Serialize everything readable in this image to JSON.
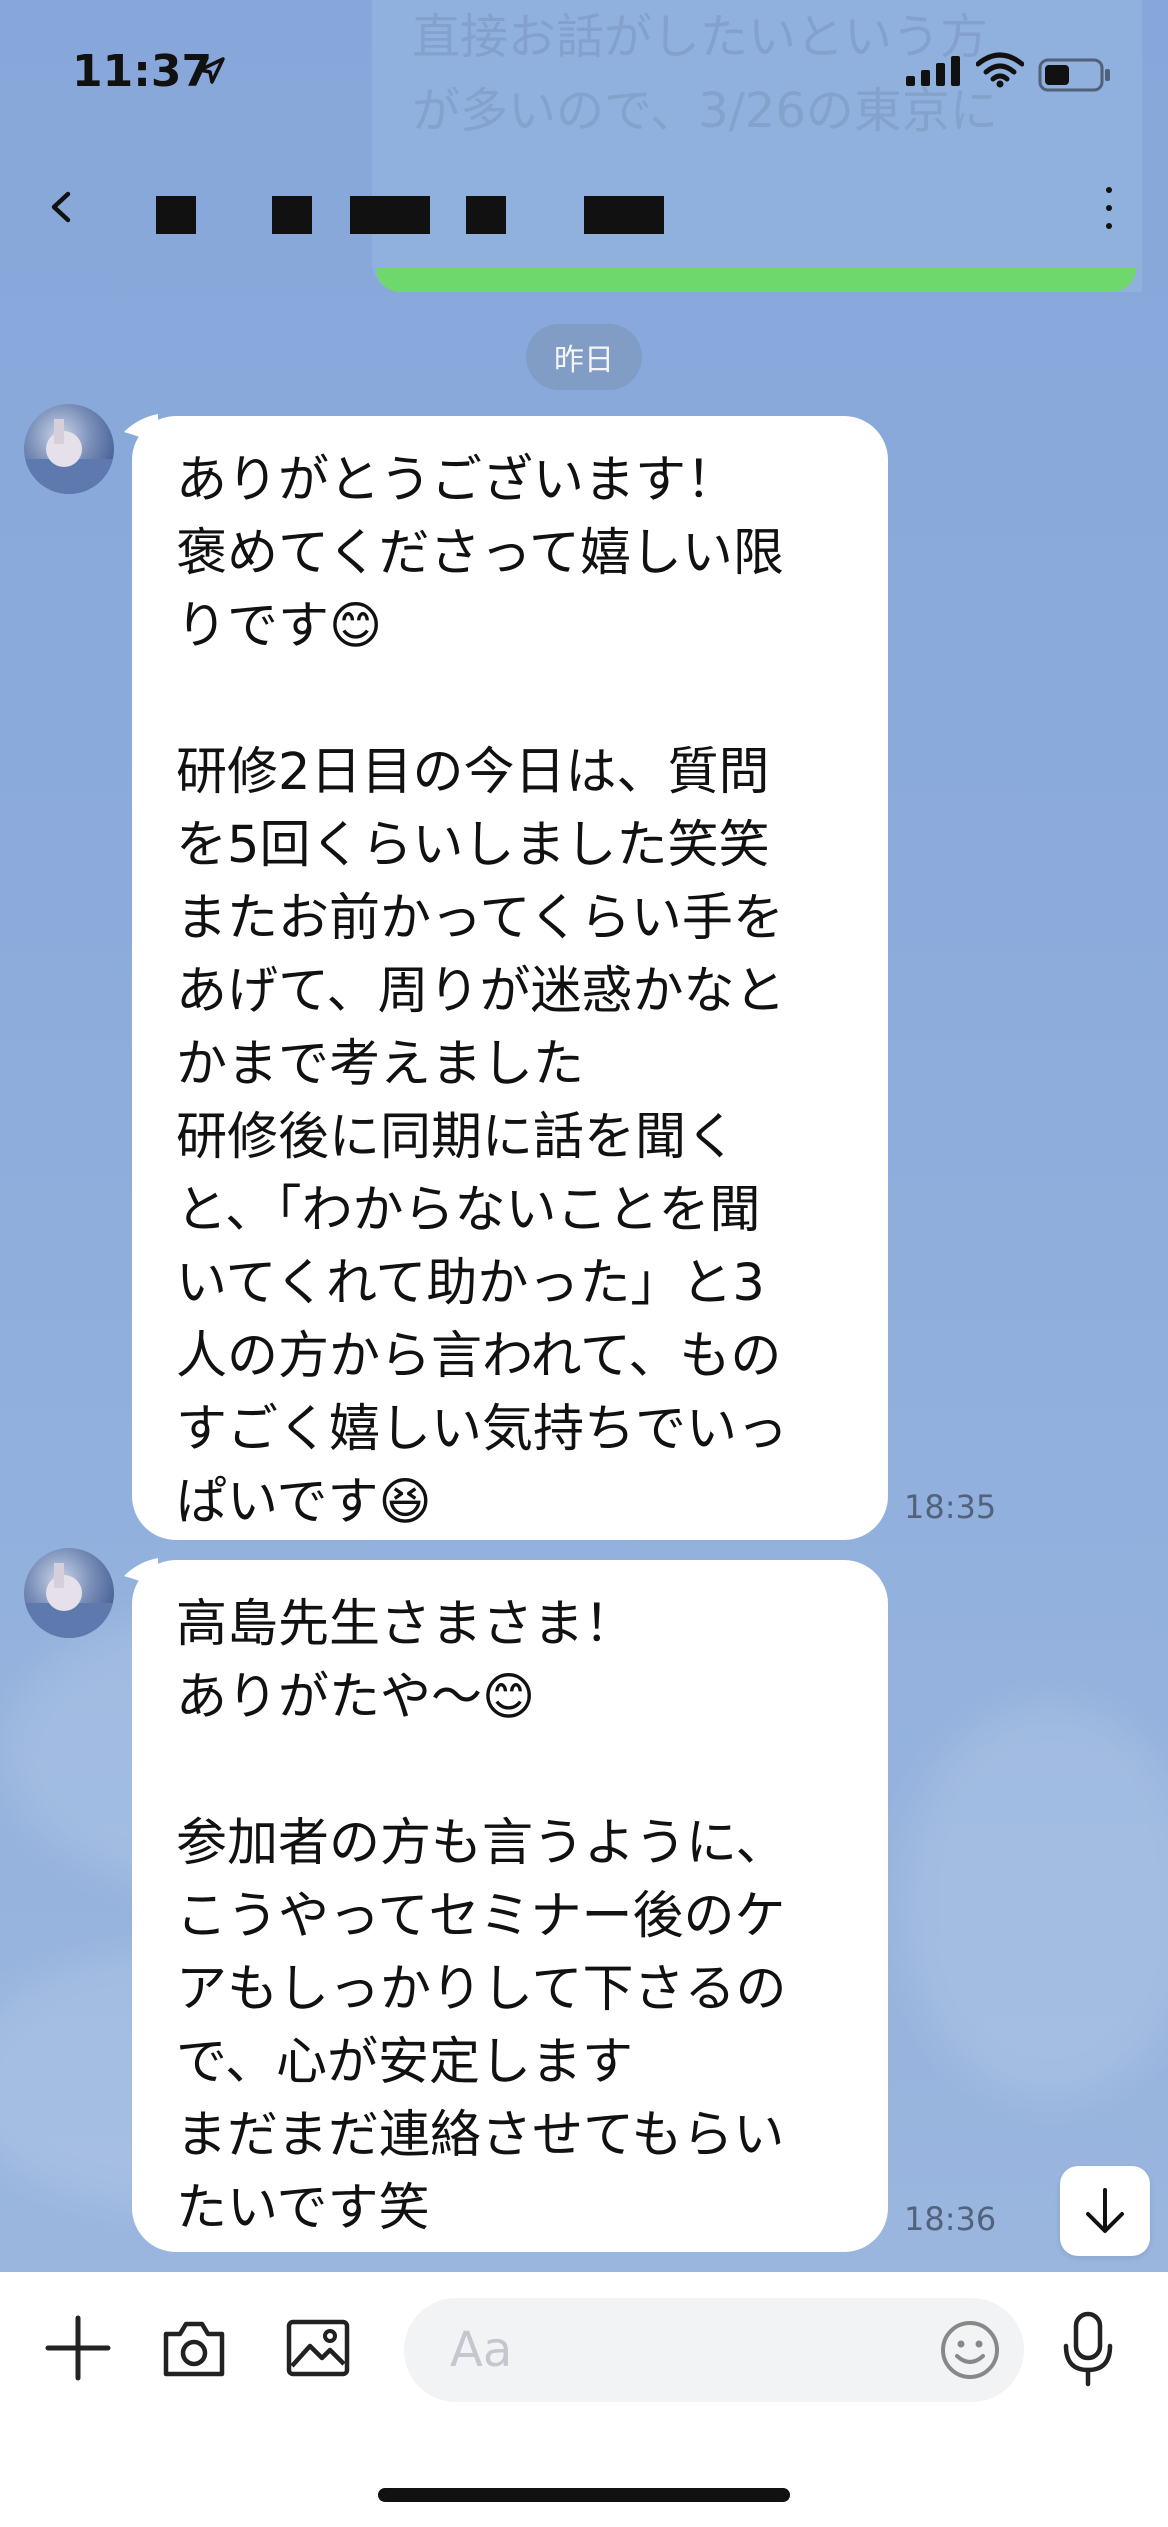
{
  "status_bar": {
    "time": "11:37"
  },
  "banner": {
    "line1": "直接お話がしたいという方",
    "line2": "が多いので、3/26の東京に"
  },
  "header": {
    "back_icon": "chevron-left-icon",
    "menu_icon": "more-vertical-icon"
  },
  "date_separator": "昨日",
  "messages": [
    {
      "text": "ありがとうございます！\n褒めてくださって嬉しい限\nりです😊\n\n研修2日目の今日は、質問\nを5回くらいしました笑笑\nまたお前かってくらい手を\nあげて、周りが迷惑かなと\nかまで考えました\n研修後に同期に話を聞く\nと、「わからないことを聞\nいてくれて助かった」と3\n人の方から言われて、もの\nすごく嬉しい気持ちでいっ\nぱいです😆",
      "time": "18:35"
    },
    {
      "text": "高島先生さまさま！\nありがたや〜😊\n\n参加者の方も言うように、\nこうやってセミナー後のケ\nアもしっかりして下さるの\nで、心が安定します\nまだまだ連絡させてもらい\nたいです笑",
      "time": "18:36"
    }
  ],
  "input": {
    "placeholder": "Aa"
  },
  "colors": {
    "background": "#8eaddb",
    "bubble": "#ffffff",
    "accent_green": "#6fd86d"
  }
}
